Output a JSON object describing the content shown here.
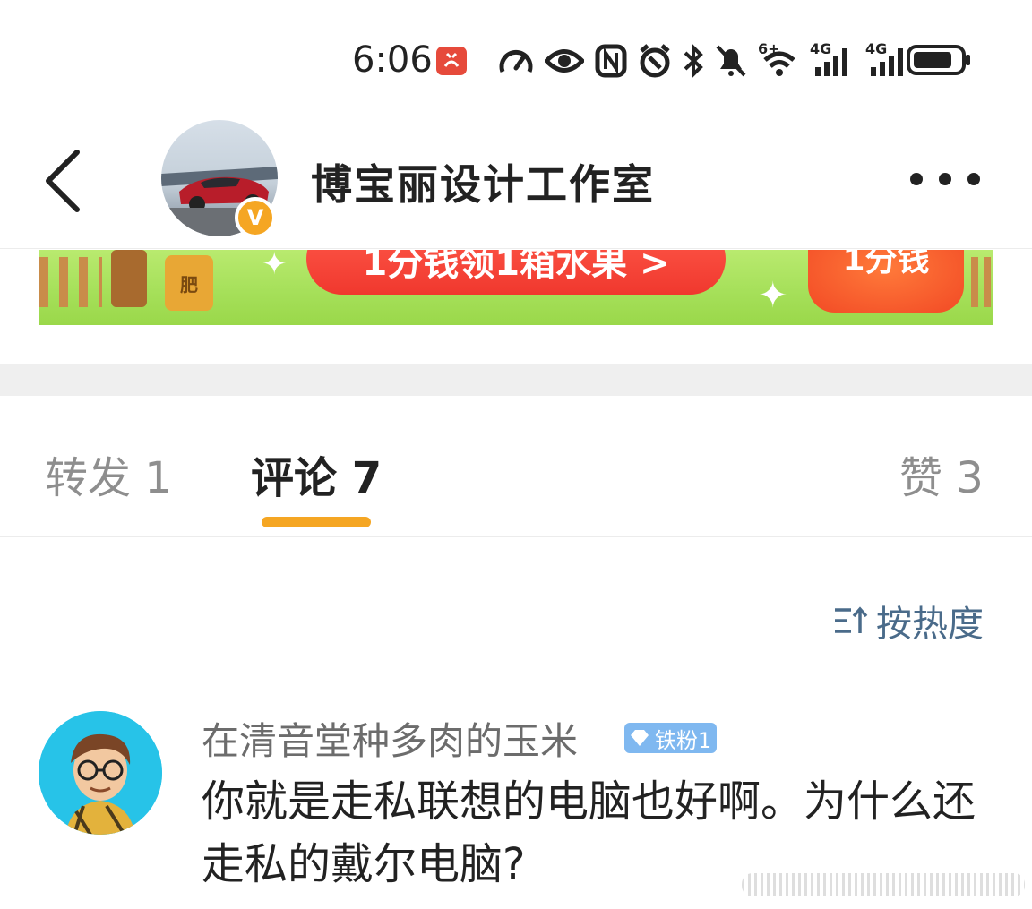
{
  "status_bar": {
    "time": "6:06",
    "icons": [
      "speedometer-icon",
      "eye-icon",
      "nfc-icon",
      "alarm-icon",
      "bluetooth-icon",
      "mute-bell-icon",
      "wifi-icon",
      "signal-4g-1-icon",
      "signal-4g-2-icon",
      "battery-icon"
    ],
    "network_label_1": "4G",
    "network_label_2": "4G",
    "wifi_label": "6+"
  },
  "header": {
    "title": "博宝丽设计工作室",
    "verified_mark": "V"
  },
  "banner": {
    "main_text": "1分钱领1箱水果 >",
    "right_text": "1分钱",
    "fertilizer_text": "肥"
  },
  "tabs": [
    {
      "label": "转发 1"
    },
    {
      "label": "评论 7"
    },
    {
      "label": "赞 3"
    }
  ],
  "sort": {
    "label": "按热度"
  },
  "comments": [
    {
      "username": "在清音堂种多肉的玉米",
      "badge": "铁粉1",
      "text": "你就是走私联想的电脑也好啊。为什么还走私的戴尔电脑?"
    }
  ],
  "colors": {
    "accent": "#f5a623",
    "link_blue": "#4a6b8a",
    "badge_blue": "#7fb8f0"
  }
}
